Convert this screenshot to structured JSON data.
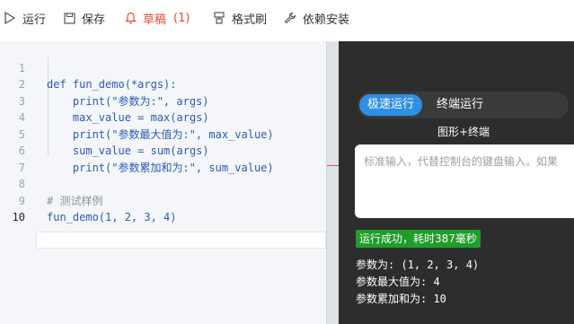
{
  "toolbar": {
    "run_label": "运行",
    "save_label": "保存",
    "draft_label": "草稿",
    "draft_count": "(1)",
    "format_label": "格式刷",
    "deps_label": "依赖安装"
  },
  "editor": {
    "lines": [
      {
        "num": "1",
        "text": "def fun_demo(*args):"
      },
      {
        "num": "2",
        "text": "    print(\"参数为:\", args)"
      },
      {
        "num": "3",
        "text": "    max_value = max(args)"
      },
      {
        "num": "4",
        "text": "    print(\"参数最大值为:\", max_value)"
      },
      {
        "num": "5",
        "text": "    sum_value = sum(args)"
      },
      {
        "num": "6",
        "text": "    print(\"参数累加和为:\", sum_value)"
      },
      {
        "num": "7",
        "text": ""
      },
      {
        "num": "8",
        "text": "# 测试样例"
      },
      {
        "num": "9",
        "text": "fun_demo(1, 2, 3, 4)"
      },
      {
        "num": "10",
        "text": ""
      }
    ]
  },
  "runner": {
    "mode_fast": "极速运行",
    "mode_terminal": "终端运行",
    "mode_gui": "图形+终端",
    "stdin_placeholder": "标准输入，代替控制台的键盘输入。如果",
    "status": "运行成功，耗时387毫秒",
    "output": [
      "参数为: (1, 2, 3, 4)",
      "参数最大值为: 4",
      "参数累加和为: 10"
    ]
  },
  "colors": {
    "accent": "#2f8fe4",
    "draft": "#e74c3c",
    "success": "#1f9d2a",
    "runner_bg": "#2d2d2d"
  }
}
